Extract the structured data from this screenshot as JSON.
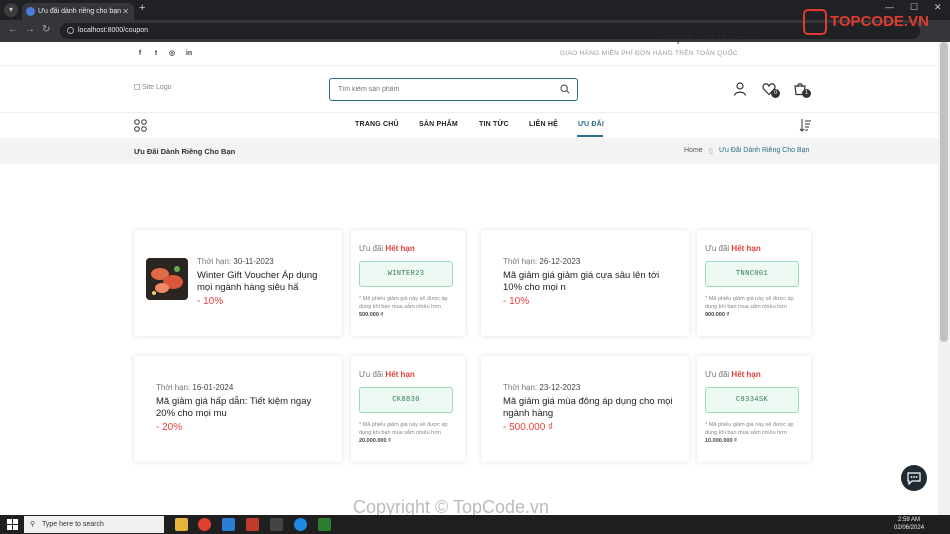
{
  "browser": {
    "tab_title": "Ưu đãi dành riêng cho bạn",
    "url": "localhost:8000/coupon"
  },
  "topbar": {
    "social_icons": [
      "facebook-icon",
      "twitter-icon",
      "instagram-icon",
      "linkedin-icon"
    ],
    "social_glyphs": [
      "f",
      "t",
      "◎",
      "in"
    ],
    "shipping_text": "GIAO HÀNG MIỄN PHÍ ĐƠN HÀNG TRÊN TOÀN QUỐC"
  },
  "header": {
    "logo_alt": "Site Logo",
    "search_placeholder": "Tìm kiếm sản phẩm",
    "wishlist_count": "0",
    "cart_count": "1"
  },
  "nav": {
    "items": [
      {
        "label": "TRANG CHỦ"
      },
      {
        "label": "SẢN PHẨM"
      },
      {
        "label": "TIN TỨC"
      },
      {
        "label": "LIÊN HỆ"
      },
      {
        "label": "ƯU ĐÃI"
      }
    ],
    "active_index": 4
  },
  "breadcrumb": {
    "title": "Ưu Đãi Dành Riêng Cho Bạn",
    "home": "Home",
    "current": "Ưu Đãi Dành Riêng Cho Bạn"
  },
  "coupon_labels": {
    "expiry_prefix": "Thời hạn:",
    "status_prefix": "Ưu đãi",
    "status_value": "Hết hạn",
    "note_prefix": "* Mã phiếu giảm giá này sẽ được áp dụng khi bạn mua sắm nhiều hơn"
  },
  "coupons": [
    {
      "expiry": "30-11-2023",
      "title": "Winter Gift Voucher Áp dụng mọi ngành hàng siêu hấ",
      "discount": "- 10%",
      "code": "WINTER23",
      "min_amount": "500.000 ₫",
      "has_image": true
    },
    {
      "expiry": "26-12-2023",
      "title": "Mã giảm giá giảm giá cựa sâu lên tới 10% cho mọi n",
      "discount": "- 10%",
      "code": "TNNC001",
      "min_amount": "900.000 ₫",
      "has_image": false
    },
    {
      "expiry": "16-01-2024",
      "title": "Mã giảm giá hấp dẫn: Tiết kiệm ngay 20% cho mọi mu",
      "discount": "- 20%",
      "code": "CK8830",
      "min_amount": "20.000.000 ₫",
      "has_image": false
    },
    {
      "expiry": "23-12-2023",
      "title": "Mã giảm giá mùa đông áp dụng cho mọi ngành hàng",
      "discount": "- 500.000 ₫",
      "code": "C9334SK",
      "min_amount": "10.000.000 ₫",
      "has_image": false
    }
  ],
  "watermark": {
    "top": "TopCode.vn",
    "brand": "TOPCODE.VN",
    "bottom": "Copyright © TopCode.vn"
  },
  "taskbar": {
    "search_placeholder": "Type here to search",
    "time": "2:59 AM",
    "date": "02/06/2024"
  },
  "colors": {
    "accent": "#2c6e8a",
    "discount_red": "#e0413a",
    "code_green": "#2a7a56"
  }
}
